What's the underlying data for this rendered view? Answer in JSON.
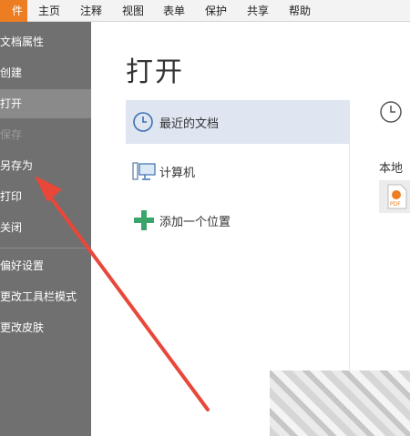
{
  "menubar": {
    "file_label": "件",
    "items": [
      "主页",
      "注释",
      "视图",
      "表单",
      "保护",
      "共享",
      "帮助"
    ]
  },
  "sidebar": {
    "items": [
      {
        "label": "文档属性"
      },
      {
        "label": "创建"
      },
      {
        "label": "打开"
      },
      {
        "label": "保存"
      },
      {
        "label": "另存为"
      },
      {
        "label": "打印"
      },
      {
        "label": "关闭"
      },
      {
        "label": "偏好设置"
      },
      {
        "label": "更改工具栏模式"
      },
      {
        "label": "更改皮肤"
      }
    ]
  },
  "main": {
    "title": "打开",
    "places": [
      {
        "label": "最近的文档",
        "icon": "clock-icon"
      },
      {
        "label": "计算机",
        "icon": "computer-icon"
      },
      {
        "label": "添加一个位置",
        "icon": "plus-icon"
      }
    ],
    "recent": {
      "section_label": "本地",
      "icon": "clock-icon",
      "file_icon": "pdf-file-icon"
    }
  },
  "colors": {
    "accent": "#ec7d22",
    "sidebar_bg": "#707070",
    "selected_place": "#dfe6f1",
    "arrow": "#e8473a",
    "add_icon": "#3aa56a"
  }
}
